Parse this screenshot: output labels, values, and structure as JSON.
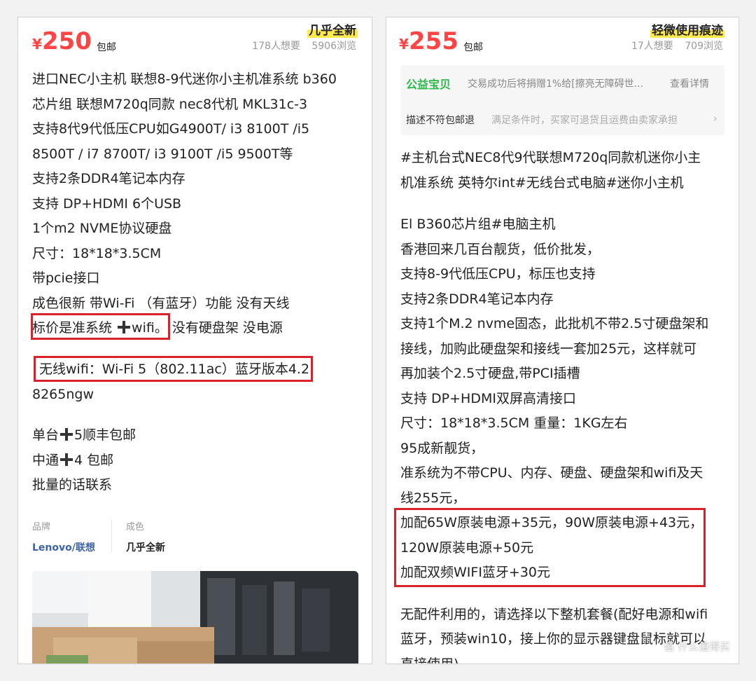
{
  "left": {
    "yen": "¥",
    "price": "250",
    "shipping": "包邮",
    "condition": "几乎全新",
    "wants": "178人想要",
    "views": "5906浏览",
    "lines": [
      "进口NEC小主机 联想8-9代迷你小主机准系统 b360",
      "芯片组  联想M720q同款 nec8代机 MKL31c-3",
      "支持8代9代低压CPU如G4900T/ i3 8100T /i5",
      "8500T / i7 8700T/ i3 9100T /i5 9500T等",
      "支持2条DDR4笔记本内存",
      "支持 DP+HDMI  6个USB",
      "1个m2 NVME协议硬盘",
      "尺寸：18*18*3.5CM",
      "带pcie接口",
      "成色很新 带Wi-Fi （有蓝牙）功能  没有天线"
    ],
    "line_price_a": "标价是准系统 ",
    "line_price_b": "wifi。",
    "line_price_c": "没有硬盘架 没电源",
    "wifi_line": "无线wifi：Wi-Fi 5（802.11ac）蓝牙版本4.2",
    "wifi_model": "8265ngw",
    "ship1_a": "单台",
    "ship1_b": "5顺丰包邮",
    "ship2_a": "中通",
    "ship2_b": "4 包邮",
    "bulk": "批量的话联系",
    "brand_label": "品牌",
    "brand_value": "Lenovo/联想",
    "cond_label": "成色",
    "cond_value": "几乎全新"
  },
  "right": {
    "yen": "¥",
    "price": "255",
    "shipping": "包邮",
    "condition": "轻微使用痕迹",
    "wants": "17人想要",
    "views": "709浏览",
    "charity_tag": "公益宝贝",
    "charity_text": "交易成功后将捐赠1%给[擦亮无障碍世...",
    "charity_link": "查看详情",
    "refund_tag": "描述不符包邮退",
    "refund_text": "满足条件时，买家可退货且运费由卖家承担",
    "refund_arrow": "›",
    "lines_a": [
      "#主机台式NEC8代9代联想M720q同款机迷你小主",
      "机准系统 英特尔int#无线台式电脑#迷你小主机"
    ],
    "lines_b": [
      "El B360芯片组#电脑主机",
      "香港回来几百台靓货，低价批发，",
      "支持8-9代低压CPU，标压也支持",
      "支持2条DDR4笔记本内存",
      "支持1个M.2 nvme固态，此批机不带2.5寸硬盘架和",
      "接线，加购此硬盘架和接线一套加25元，这样就可",
      "再加装个2.5寸硬盘,带PCI插槽",
      "支持 DP+HDMI双屏高清接口",
      "尺寸：18*18*3.5CM 重量：1KG左右",
      "95成新靓货，",
      "准系统为不带CPU、内存、硬盘、硬盘架和wifi及天",
      "线255元，"
    ],
    "lines_box": [
      "加配65W原装电源+35元，90W原装电源+43元，",
      "120W原装电源+50元",
      "加配双频WIFI蓝牙+30元"
    ],
    "lines_c": [
      "无配件利用的，请选择以下整机套餐(配好电源和wifi",
      "蓝牙，预装win10，接上你的显示器键盘鼠标就可以",
      "直接使用)"
    ]
  },
  "watermark": "值 什么值得买"
}
